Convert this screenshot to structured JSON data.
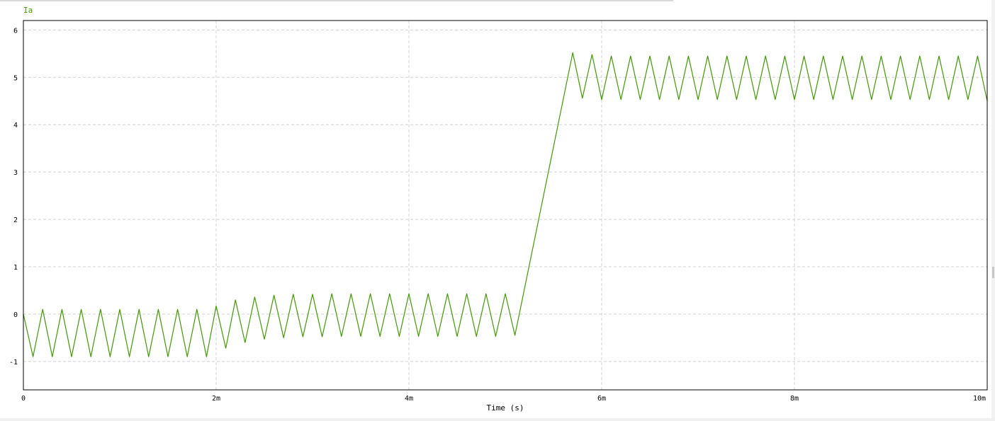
{
  "chart_data": {
    "type": "line",
    "title": "",
    "xlabel": "Time (s)",
    "ylabel": "",
    "xlim": [
      0,
      0.01
    ],
    "ylim": [
      -1.6,
      6.2
    ],
    "x_ticks": [
      0,
      0.002,
      0.004,
      0.006,
      0.008,
      0.01
    ],
    "x_tick_labels": [
      "0",
      "2m",
      "4m",
      "6m",
      "8m",
      "10m"
    ],
    "y_ticks": [
      -1,
      0,
      1,
      2,
      3,
      4,
      5,
      6
    ],
    "y_tick_labels": [
      "-1",
      "0",
      "1",
      "2",
      "3",
      "4",
      "5",
      "6"
    ],
    "grid": true,
    "legend": "top-left",
    "series": [
      {
        "name": "Ia",
        "color": "#3f9b00",
        "points": [
          [
            0.0,
            0.0
          ],
          [
            0.0001,
            -0.9
          ],
          [
            0.0002,
            0.1
          ],
          [
            0.0003,
            -0.9
          ],
          [
            0.0004,
            0.1
          ],
          [
            0.0005,
            -0.9
          ],
          [
            0.0006,
            0.1
          ],
          [
            0.0007,
            -0.9
          ],
          [
            0.0008,
            0.1
          ],
          [
            0.0009,
            -0.9
          ],
          [
            0.001,
            0.1
          ],
          [
            0.0011,
            -0.9
          ],
          [
            0.0012,
            0.1
          ],
          [
            0.0013,
            -0.9
          ],
          [
            0.0014,
            0.1
          ],
          [
            0.0015,
            -0.9
          ],
          [
            0.0016,
            0.1
          ],
          [
            0.0017,
            -0.9
          ],
          [
            0.0018,
            0.1
          ],
          [
            0.0019,
            -0.9
          ],
          [
            0.002,
            0.17
          ],
          [
            0.0021,
            -0.72
          ],
          [
            0.0022,
            0.3
          ],
          [
            0.0023,
            -0.6
          ],
          [
            0.0024,
            0.36
          ],
          [
            0.0025,
            -0.53
          ],
          [
            0.0026,
            0.4
          ],
          [
            0.0027,
            -0.5
          ],
          [
            0.0028,
            0.42
          ],
          [
            0.0029,
            -0.48
          ],
          [
            0.003,
            0.42
          ],
          [
            0.0031,
            -0.48
          ],
          [
            0.0032,
            0.43
          ],
          [
            0.0033,
            -0.47
          ],
          [
            0.0034,
            0.43
          ],
          [
            0.0035,
            -0.47
          ],
          [
            0.0036,
            0.43
          ],
          [
            0.0037,
            -0.47
          ],
          [
            0.0038,
            0.43
          ],
          [
            0.0039,
            -0.47
          ],
          [
            0.004,
            0.43
          ],
          [
            0.0041,
            -0.47
          ],
          [
            0.0042,
            0.43
          ],
          [
            0.0043,
            -0.47
          ],
          [
            0.0044,
            0.43
          ],
          [
            0.0045,
            -0.47
          ],
          [
            0.0046,
            0.43
          ],
          [
            0.0047,
            -0.47
          ],
          [
            0.0048,
            0.43
          ],
          [
            0.0049,
            -0.47
          ],
          [
            0.005,
            0.43
          ],
          [
            0.0051,
            -0.45
          ],
          [
            0.0057,
            5.52
          ],
          [
            0.0058,
            4.56
          ],
          [
            0.0059,
            5.48
          ],
          [
            0.006,
            4.53
          ],
          [
            0.0061,
            5.45
          ],
          [
            0.0062,
            4.53
          ],
          [
            0.0063,
            5.45
          ],
          [
            0.0064,
            4.53
          ],
          [
            0.0065,
            5.45
          ],
          [
            0.0066,
            4.53
          ],
          [
            0.0067,
            5.45
          ],
          [
            0.0068,
            4.53
          ],
          [
            0.0069,
            5.45
          ],
          [
            0.007,
            4.53
          ],
          [
            0.0071,
            5.45
          ],
          [
            0.0072,
            4.53
          ],
          [
            0.0073,
            5.45
          ],
          [
            0.0074,
            4.53
          ],
          [
            0.0075,
            5.45
          ],
          [
            0.0076,
            4.53
          ],
          [
            0.0077,
            5.45
          ],
          [
            0.0078,
            4.53
          ],
          [
            0.0079,
            5.45
          ],
          [
            0.008,
            4.53
          ],
          [
            0.0081,
            5.45
          ],
          [
            0.0082,
            4.53
          ],
          [
            0.0083,
            5.45
          ],
          [
            0.0084,
            4.53
          ],
          [
            0.0085,
            5.45
          ],
          [
            0.0086,
            4.53
          ],
          [
            0.0087,
            5.45
          ],
          [
            0.0088,
            4.53
          ],
          [
            0.0089,
            5.45
          ],
          [
            0.009,
            4.53
          ],
          [
            0.0091,
            5.45
          ],
          [
            0.0092,
            4.53
          ],
          [
            0.0093,
            5.45
          ],
          [
            0.0094,
            4.53
          ],
          [
            0.0095,
            5.45
          ],
          [
            0.0096,
            4.53
          ],
          [
            0.0097,
            5.45
          ],
          [
            0.0098,
            4.53
          ],
          [
            0.0099,
            5.45
          ],
          [
            0.01,
            4.5
          ]
        ]
      }
    ]
  }
}
